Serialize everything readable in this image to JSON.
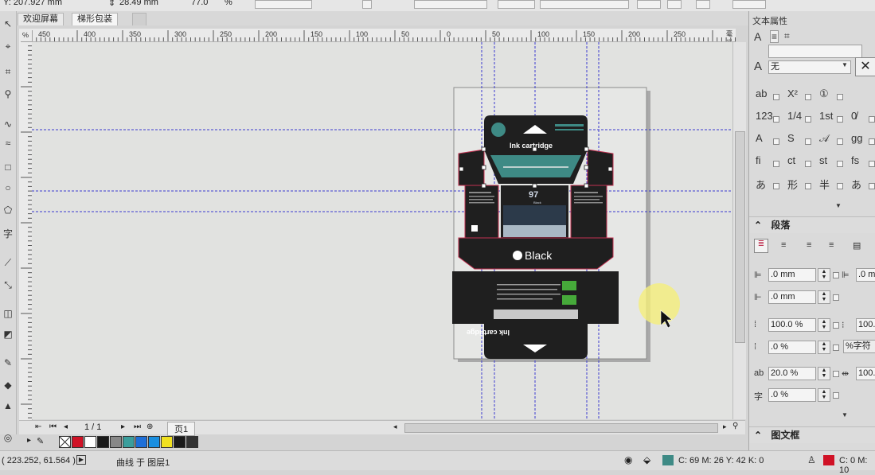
{
  "topbar": {
    "y_coord": "Y: 207.927 mm",
    "height_value": "28.49 mm",
    "scale_value": "77.0",
    "percent_sign": "%"
  },
  "tabs": [
    {
      "label": "欢迎屏幕"
    },
    {
      "label": "梯形包装"
    }
  ],
  "ruler": {
    "corner_label": "℅",
    "h_ticks": [
      "450",
      "400",
      "350",
      "300",
      "250",
      "200",
      "150",
      "100",
      "50",
      "0",
      "50",
      "100",
      "150",
      "200",
      "250"
    ],
    "unit_label": "毫米",
    "v_ticks": [
      "0",
      "00",
      "02",
      "09",
      "0"
    ]
  },
  "artwork": {
    "top_title": "Ink cartridge",
    "number": "97",
    "number_small": "Black",
    "black_label": "Black",
    "bottom_title": "Ink cartridge",
    "bottom_small": "Black"
  },
  "page_nav": {
    "page_count": "1 / 1",
    "page_tab": "页1"
  },
  "palette": {
    "colors": [
      "#d01226",
      "#ffffff",
      "#1a1a1a",
      "#888888",
      "#3b9e9c",
      "#1e6fd8",
      "#1a8fe0",
      "#f0e020",
      "#1a1a1a",
      "#333333"
    ]
  },
  "status": {
    "cursor_coords": "( 223.252, 61.564 )",
    "object_info": "曲线 于 图层1",
    "fill_color_text": "C: 69 M: 26 Y: 42 K: 0",
    "fill_color": "#3e8a85",
    "outline_color_text": "C: 0 M: 10",
    "outline_color": "#d01226"
  },
  "right_panel": {
    "title": "文本属性",
    "font_none": "无",
    "section_paragraph": "段落",
    "indent_left": ".0 mm",
    "indent_first": ".0 mm",
    "indent_right_partial": ".0 m",
    "line_spacing": "100.0 %",
    "line_spacing_right": "100.",
    "para_before": ".0 %",
    "para_unit": "%字符",
    "char_spacing": "20.0 %",
    "word_spacing_right": "100.",
    "lang_spacing": ".0 %",
    "section_frame": "图文框",
    "glyphs_row1": [
      "ab",
      "X²",
      "①"
    ],
    "glyphs_row2": [
      "123",
      "1/4",
      "1st",
      "0̸"
    ],
    "glyphs_row3": [
      "A",
      "S",
      "𝒜",
      "gg"
    ],
    "glyphs_row4": [
      "fi",
      "ct",
      "st",
      "fs"
    ],
    "glyphs_row5": [
      "あ",
      "形",
      "半",
      "あ"
    ]
  }
}
